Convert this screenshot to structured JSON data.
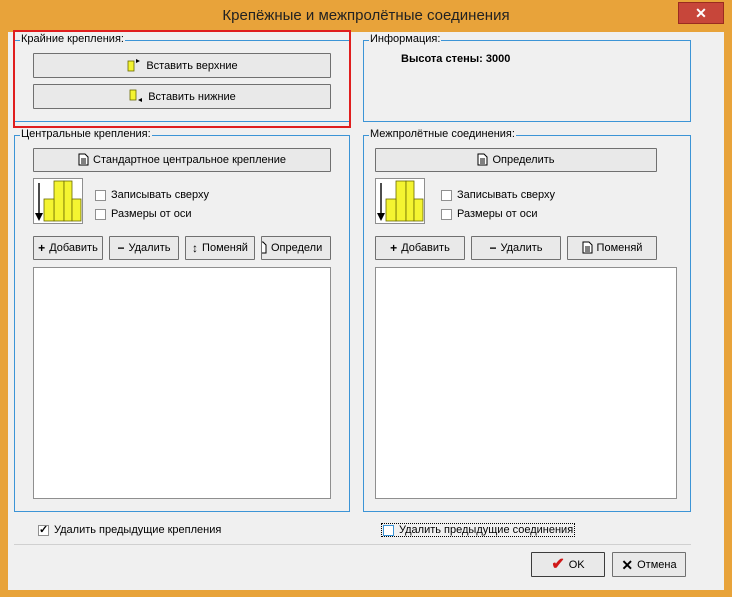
{
  "window": {
    "title": "Крепёжные и межпролётные соединения",
    "close_label": "✕"
  },
  "edge_fastenings": {
    "legend": "Крайние крепления:",
    "insert_top_label": "Вставить верхние",
    "insert_bottom_label": "Вставить нижние"
  },
  "info": {
    "legend": "Информация:",
    "wall_height_label": "Высота стены:",
    "wall_height_value": "3000"
  },
  "central_fastenings": {
    "legend": "Центральные крепления:",
    "standard_button_label": "Стандартное центральное крепление",
    "write_from_top_label": "Записывать сверху",
    "write_from_top_checked": false,
    "axis_dimensions_label": "Размеры от оси",
    "axis_dimensions_checked": false,
    "add_label": "Добавить",
    "delete_label": "Удалить",
    "swap_label": "Поменяй",
    "define_label": "Определи"
  },
  "span_connections": {
    "legend": "Межпролётные соединения:",
    "define_button_label": "Определить",
    "write_from_top_label": "Записывать сверху",
    "write_from_top_checked": false,
    "axis_dimensions_label": "Размеры от оси",
    "axis_dimensions_checked": false,
    "add_label": "Добавить",
    "delete_label": "Удалить",
    "swap_label": "Поменяй"
  },
  "footer": {
    "delete_prev_fastenings_label": "Удалить предыдущие крепления",
    "delete_prev_fastenings_checked": true,
    "delete_prev_connections_label": "Удалить предыдущие соединения",
    "delete_prev_connections_checked": false,
    "ok_label": "OK",
    "cancel_label": "Отмена"
  },
  "colors": {
    "title_bar": "#e8a33a",
    "group_border": "#3c94d6",
    "highlight": "#e01e1e",
    "close_button": "#c7463a",
    "icon_yellow": "#f4f431"
  }
}
